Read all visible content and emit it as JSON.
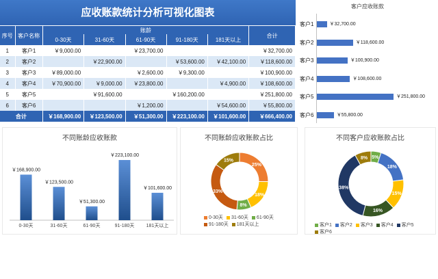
{
  "title": "应收账款统计分析可视化图表",
  "table": {
    "headers": {
      "index": "序号",
      "name": "客户名称",
      "aging": "账龄",
      "total": "合计",
      "buckets": [
        "0-30天",
        "31-60天",
        "61-90天",
        "91-180天",
        "181天以上"
      ]
    },
    "rows": [
      {
        "idx": "1",
        "name": "客户1",
        "c1": "￥9,000.00",
        "c2": "",
        "c3": "￥23,700.00",
        "c4": "",
        "c5": "",
        "total": "￥32,700.00"
      },
      {
        "idx": "2",
        "name": "客户2",
        "c1": "",
        "c2": "￥22,900.00",
        "c3": "",
        "c4": "￥53,600.00",
        "c5": "￥42,100.00",
        "total": "￥118,600.00"
      },
      {
        "idx": "3",
        "name": "客户3",
        "c1": "￥89,000.00",
        "c2": "",
        "c3": "￥2,600.00",
        "c4": "￥9,300.00",
        "c5": "",
        "total": "￥100,900.00"
      },
      {
        "idx": "4",
        "name": "客户4",
        "c1": "￥70,900.00",
        "c2": "￥9,000.00",
        "c3": "￥23,800.00",
        "c4": "",
        "c5": "￥4,900.00",
        "total": "￥108,600.00"
      },
      {
        "idx": "5",
        "name": "客户5",
        "c1": "",
        "c2": "￥91,600.00",
        "c3": "",
        "c4": "￥160,200.00",
        "c5": "",
        "total": "￥251,800.00"
      },
      {
        "idx": "6",
        "name": "客户6",
        "c1": "",
        "c2": "",
        "c3": "￥1,200.00",
        "c4": "",
        "c5": "￥54,600.00",
        "total": "￥55,800.00"
      }
    ],
    "total_row": {
      "label": "合计",
      "c1": "￥168,900.00",
      "c2": "￥123,500.00",
      "c3": "￥51,300.00",
      "c4": "￥223,100.00",
      "c5": "￥101,600.00",
      "total": "￥666,400.00"
    }
  },
  "chart_data": [
    {
      "type": "bar",
      "orientation": "horizontal",
      "title": "客户应收账款",
      "categories": [
        "客户1",
        "客户2",
        "客户3",
        "客户4",
        "客户5",
        "客户6"
      ],
      "values": [
        32700,
        118600,
        100900,
        108600,
        251800,
        55800
      ],
      "labels": [
        "￥32,700.00",
        "￥118,600.00",
        "￥100,900.00",
        "￥108,600.00",
        "￥251,800.00",
        "￥55,800.00"
      ],
      "color": "#4472c4"
    },
    {
      "type": "bar",
      "title": "不同账龄应收账款",
      "categories": [
        "0-30天",
        "31-60天",
        "61-90天",
        "91-180天",
        "181天以上"
      ],
      "values": [
        168900,
        123500,
        51300,
        223100,
        101600
      ],
      "labels": [
        "￥168,900.00",
        "￥123,500.00",
        "￥51,300.00",
        "￥223,100.00",
        "￥101,600.00"
      ],
      "color": "#2f64b3"
    },
    {
      "type": "pie",
      "donut": true,
      "title": "不同账龄应收账款占比",
      "categories": [
        "0-30天",
        "31-60天",
        "61-90天",
        "91-180天",
        "181天以上"
      ],
      "values": [
        25,
        18,
        8,
        33,
        15
      ],
      "labels": [
        "25%",
        "18%",
        "8%",
        "33%",
        "15%"
      ],
      "colors": [
        "#ed7d31",
        "#ffc000",
        "#70ad47",
        "#c55a11",
        "#9e7c0c"
      ],
      "legend": "bottom"
    },
    {
      "type": "pie",
      "donut": true,
      "title": "不同客户应收账款占比",
      "categories": [
        "客户1",
        "客户2",
        "客户3",
        "客户4",
        "客户5",
        "客户6"
      ],
      "values": [
        5,
        18,
        15,
        16,
        38,
        8
      ],
      "labels": [
        "5%",
        "18%",
        "15%",
        "16%",
        "38%",
        "8%"
      ],
      "colors": [
        "#70ad47",
        "#4472c4",
        "#ffc000",
        "#375623",
        "#203864",
        "#9e7c0c"
      ],
      "legend": "bottom"
    }
  ]
}
